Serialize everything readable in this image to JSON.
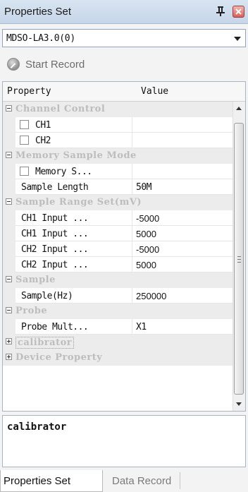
{
  "window": {
    "title": "Properties Set",
    "pin_icon": "pin-icon",
    "close_icon": "close-icon"
  },
  "device_select": {
    "value": "MDSO-LA3.0(0)"
  },
  "toolbar": {
    "start_record_label": "Start Record",
    "start_record_icon": "record-icon"
  },
  "grid": {
    "header": {
      "property": "Property",
      "value": "Value"
    },
    "categories": {
      "channel_control": "Channel Control",
      "memory_sample_mode": "Memory Sample Mode",
      "sample_range": "Sample Range Set(mV)",
      "sample": "Sample",
      "probe": "Probe",
      "calibrator": "calibrator",
      "device_property": "Device Property"
    },
    "rows": {
      "ch1": {
        "label": "CH1",
        "value": ""
      },
      "ch2": {
        "label": "CH2",
        "value": ""
      },
      "memory_s": {
        "label": "Memory S...",
        "value": ""
      },
      "sample_length": {
        "label": "Sample Length",
        "value": "50M"
      },
      "ch1_input_a": {
        "label": "CH1 Input ...",
        "value": "-5000"
      },
      "ch1_input_b": {
        "label": "CH1 Input ...",
        "value": "5000"
      },
      "ch2_input_a": {
        "label": "CH2 Input ...",
        "value": "-5000"
      },
      "ch2_input_b": {
        "label": "CH2 Input ...",
        "value": "5000"
      },
      "sample_hz": {
        "label": "Sample(Hz)",
        "value": "250000"
      },
      "probe_mult": {
        "label": "Probe Mult...",
        "value": "X1"
      }
    }
  },
  "description": {
    "title": "calibrator"
  },
  "tabs": {
    "properties_set": "Properties Set",
    "data_record": "Data Record"
  }
}
